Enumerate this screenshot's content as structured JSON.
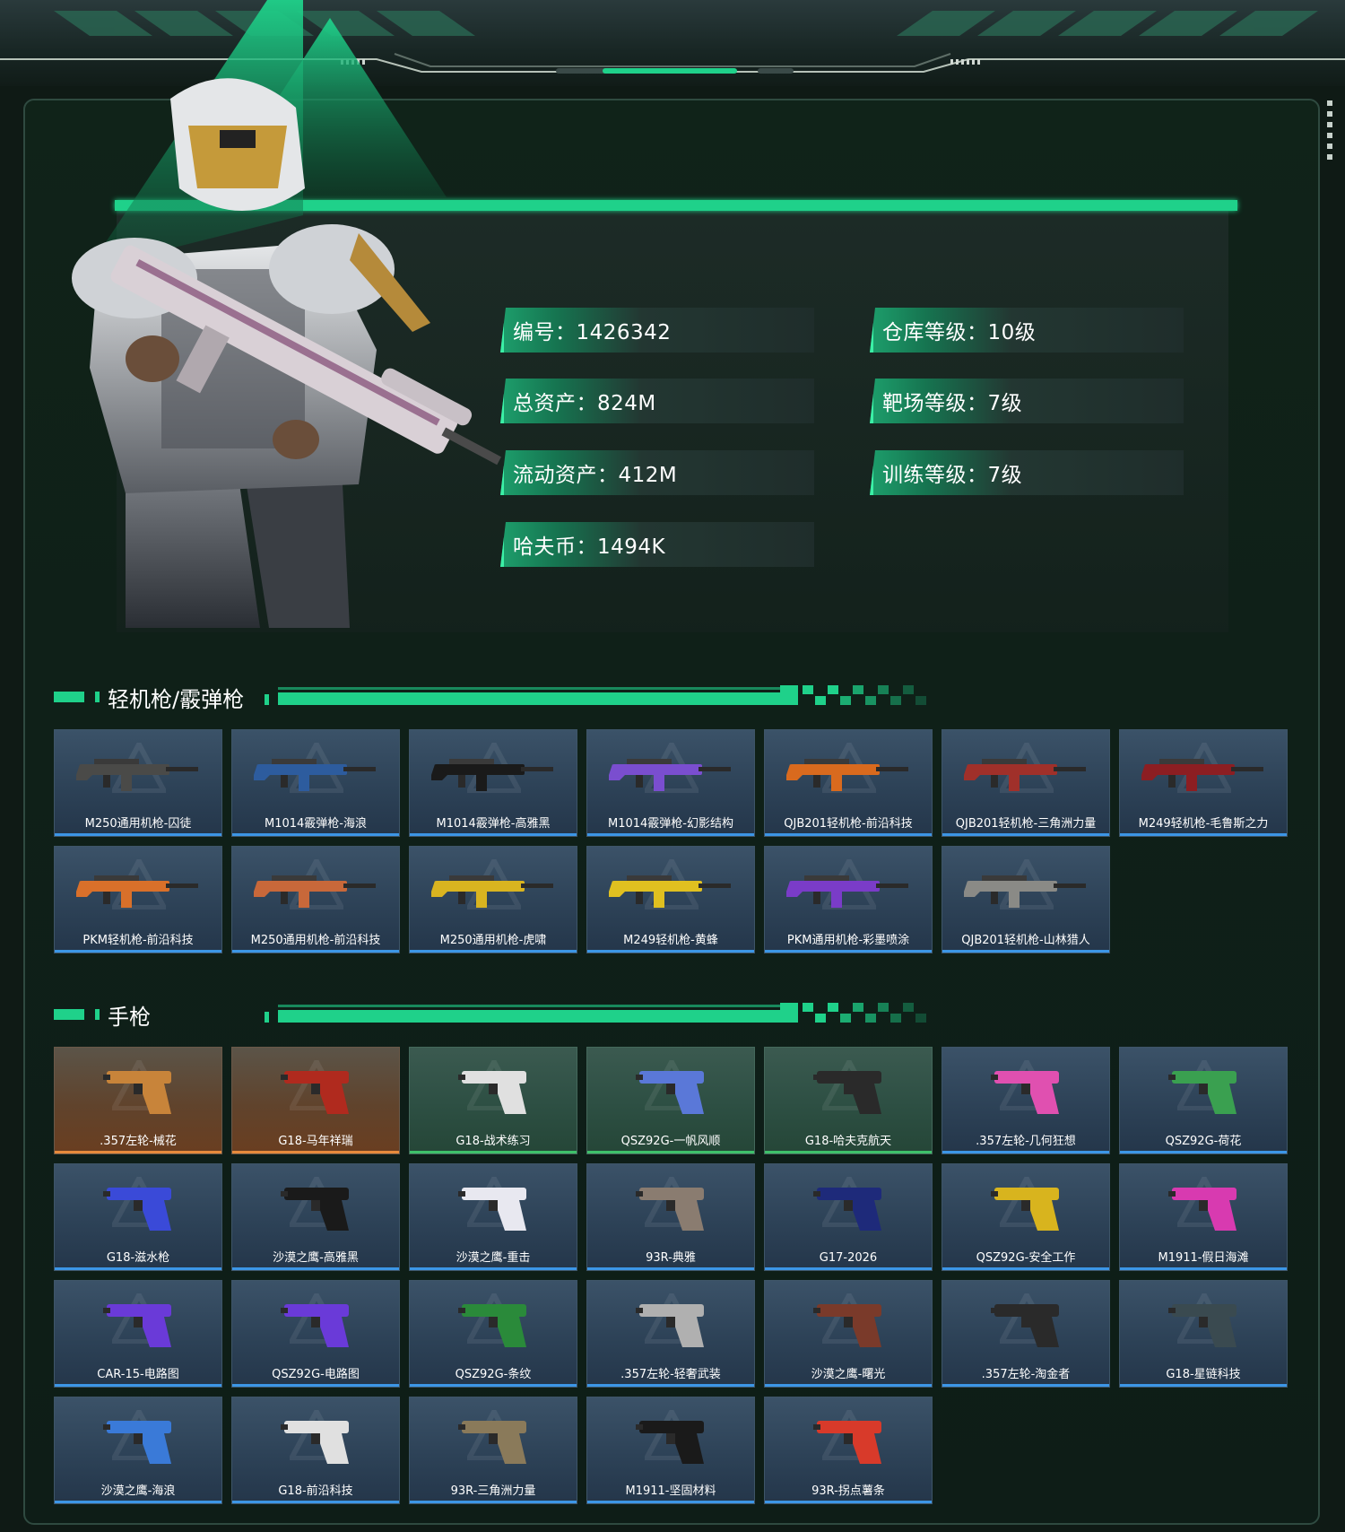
{
  "stats": [
    {
      "label": "编号：1426342"
    },
    {
      "label": "仓库等级：10级"
    },
    {
      "label": "总资产：824M"
    },
    {
      "label": "靶场等级：7级"
    },
    {
      "label": "流动资产：412M"
    },
    {
      "label": "训练等级：7级"
    },
    {
      "label": "哈夫币：1494K"
    }
  ],
  "sections": [
    {
      "title": "轻机枪/霰弹枪"
    },
    {
      "title": "手枪"
    }
  ],
  "lmg_items": [
    {
      "name": "M250通用机枪-囚徒",
      "rarity": "blue",
      "color": "#4a4a48"
    },
    {
      "name": "M1014霰弹枪-海浪",
      "rarity": "blue",
      "color": "#2d5c9e"
    },
    {
      "name": "M1014霰弹枪-高雅黑",
      "rarity": "blue",
      "color": "#1a1a1a"
    },
    {
      "name": "M1014霰弹枪-幻影结构",
      "rarity": "blue",
      "color": "#7a4ecf"
    },
    {
      "name": "QJB201轻机枪-前沿科技",
      "rarity": "blue",
      "color": "#d96a1e"
    },
    {
      "name": "QJB201轻机枪-三角洲力量",
      "rarity": "blue",
      "color": "#a0302a"
    },
    {
      "name": "M249轻机枪-毛鲁斯之力",
      "rarity": "blue",
      "color": "#8c1e22"
    },
    {
      "name": "PKM轻机枪-前沿科技",
      "rarity": "blue",
      "color": "#d9702a"
    },
    {
      "name": "M250通用机枪-前沿科技",
      "rarity": "blue",
      "color": "#c8683a"
    },
    {
      "name": "M250通用机枪-虎啸",
      "rarity": "blue",
      "color": "#d9b420"
    },
    {
      "name": "M249轻机枪-黄蜂",
      "rarity": "blue",
      "color": "#e0c020"
    },
    {
      "name": "PKM通用机枪-彩墨喷涂",
      "rarity": "blue",
      "color": "#7a3cc8"
    },
    {
      "name": "QJB201轻机枪-山林猎人",
      "rarity": "blue",
      "color": "#8a8a86"
    }
  ],
  "pistol_items": [
    {
      "name": ".357左轮-械花",
      "rarity": "orange",
      "color": "#c8843a"
    },
    {
      "name": "G18-马年祥瑞",
      "rarity": "orange",
      "color": "#b02a1e"
    },
    {
      "name": "G18-战术练习",
      "rarity": "green",
      "color": "#e0e0e0"
    },
    {
      "name": "QSZ92G-一帆风顺",
      "rarity": "green",
      "color": "#5a78d8"
    },
    {
      "name": "G18-哈夫克航天",
      "rarity": "green",
      "color": "#2a2a2a"
    },
    {
      "name": ".357左轮-几何狂想",
      "rarity": "blue",
      "color": "#e050b0"
    },
    {
      "name": "QSZ92G-荷花",
      "rarity": "blue",
      "color": "#3aa050"
    },
    {
      "name": "G18-滋水枪",
      "rarity": "blue",
      "color": "#3a4ad8"
    },
    {
      "name": "沙漠之鹰-高雅黑",
      "rarity": "blue",
      "color": "#1a1a1a"
    },
    {
      "name": "沙漠之鹰-重击",
      "rarity": "blue",
      "color": "#e8e8f0"
    },
    {
      "name": "93R-典雅",
      "rarity": "blue",
      "color": "#8a7c70"
    },
    {
      "name": "G17-2026",
      "rarity": "blue",
      "color": "#1e2a7a"
    },
    {
      "name": "QSZ92G-安全工作",
      "rarity": "blue",
      "color": "#d8b41e"
    },
    {
      "name": "M1911-假日海滩",
      "rarity": "blue",
      "color": "#d83ab0"
    },
    {
      "name": "CAR-15-电路图",
      "rarity": "blue",
      "color": "#6a3ad8"
    },
    {
      "name": "QSZ92G-电路图",
      "rarity": "blue",
      "color": "#6a3ad8"
    },
    {
      "name": "QSZ92G-条纹",
      "rarity": "blue",
      "color": "#2a8a3a"
    },
    {
      "name": ".357左轮-轻奢武装",
      "rarity": "blue",
      "color": "#b0b0b0"
    },
    {
      "name": "沙漠之鹰-曙光",
      "rarity": "blue",
      "color": "#7a3a2a"
    },
    {
      "name": ".357左轮-淘金者",
      "rarity": "blue",
      "color": "#2a2a2a"
    },
    {
      "name": "G18-星链科技",
      "rarity": "blue",
      "color": "#3a4a50"
    },
    {
      "name": "沙漠之鹰-海浪",
      "rarity": "blue",
      "color": "#3a7ad8"
    },
    {
      "name": "G18-前沿科技",
      "rarity": "blue",
      "color": "#e0e0e0"
    },
    {
      "name": "93R-三角洲力量",
      "rarity": "blue",
      "color": "#8a7a5a"
    },
    {
      "name": "M1911-坚固材料",
      "rarity": "blue",
      "color": "#1a1a1a"
    },
    {
      "name": "93R-拐点薯条",
      "rarity": "blue",
      "color": "#d83a2a"
    }
  ],
  "colors": {
    "accent": "#1fd18a",
    "blue_rarity": "#3c96e6",
    "orange_rarity": "#e68a3c",
    "green_rarity": "#3ec06a"
  }
}
